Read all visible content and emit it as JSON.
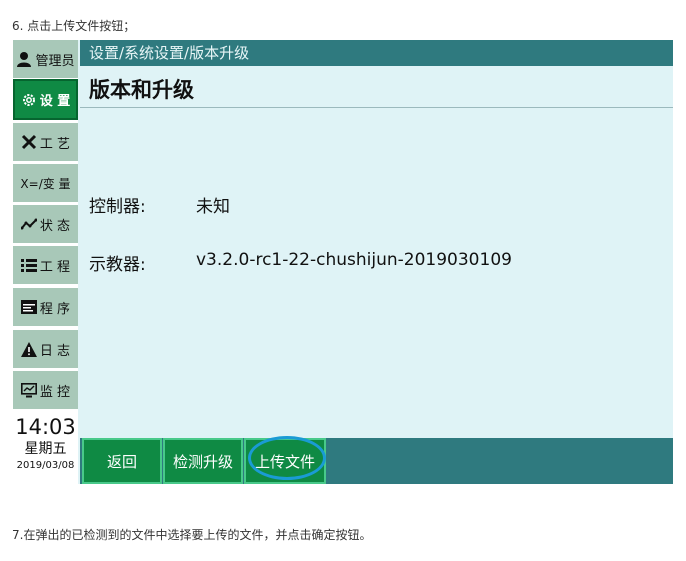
{
  "doc": {
    "step6": "6. 点击上传文件按钮；",
    "step7": "7.在弹出的已检测到的文件中选择要上传的文件，并点击确定按钮。"
  },
  "sidebar": {
    "items": [
      {
        "label": "管理员",
        "icon": "user-icon"
      },
      {
        "label": "设 置",
        "icon": "gear-icon",
        "active": true
      },
      {
        "label": "工 艺",
        "icon": "tools-icon"
      },
      {
        "label": "X=/变 量",
        "icon": "variable-icon"
      },
      {
        "label": "状 态",
        "icon": "status-icon"
      },
      {
        "label": "工 程",
        "icon": "list-icon"
      },
      {
        "label": "程 序",
        "icon": "program-icon"
      },
      {
        "label": "日 志",
        "icon": "warning-icon"
      },
      {
        "label": "监 控",
        "icon": "monitor-icon"
      }
    ],
    "clock": {
      "time": "14:03",
      "day": "星期五",
      "date": "2019/03/08"
    }
  },
  "main": {
    "breadcrumb": "设置/系统设置/版本升级",
    "title": "版本和升级",
    "rows": [
      {
        "label": "控制器:",
        "value": "未知"
      },
      {
        "label": "示教器:",
        "value": "v3.2.0-rc1-22-chushijun-2019030109"
      }
    ]
  },
  "actions": {
    "back": "返回",
    "check": "检测升级",
    "upload": "上传文件"
  },
  "colors": {
    "accent_green": "#0f8a44",
    "header_teal": "#2f7a7f",
    "background": "#dff3f6",
    "highlight": "#1a9bd4"
  }
}
